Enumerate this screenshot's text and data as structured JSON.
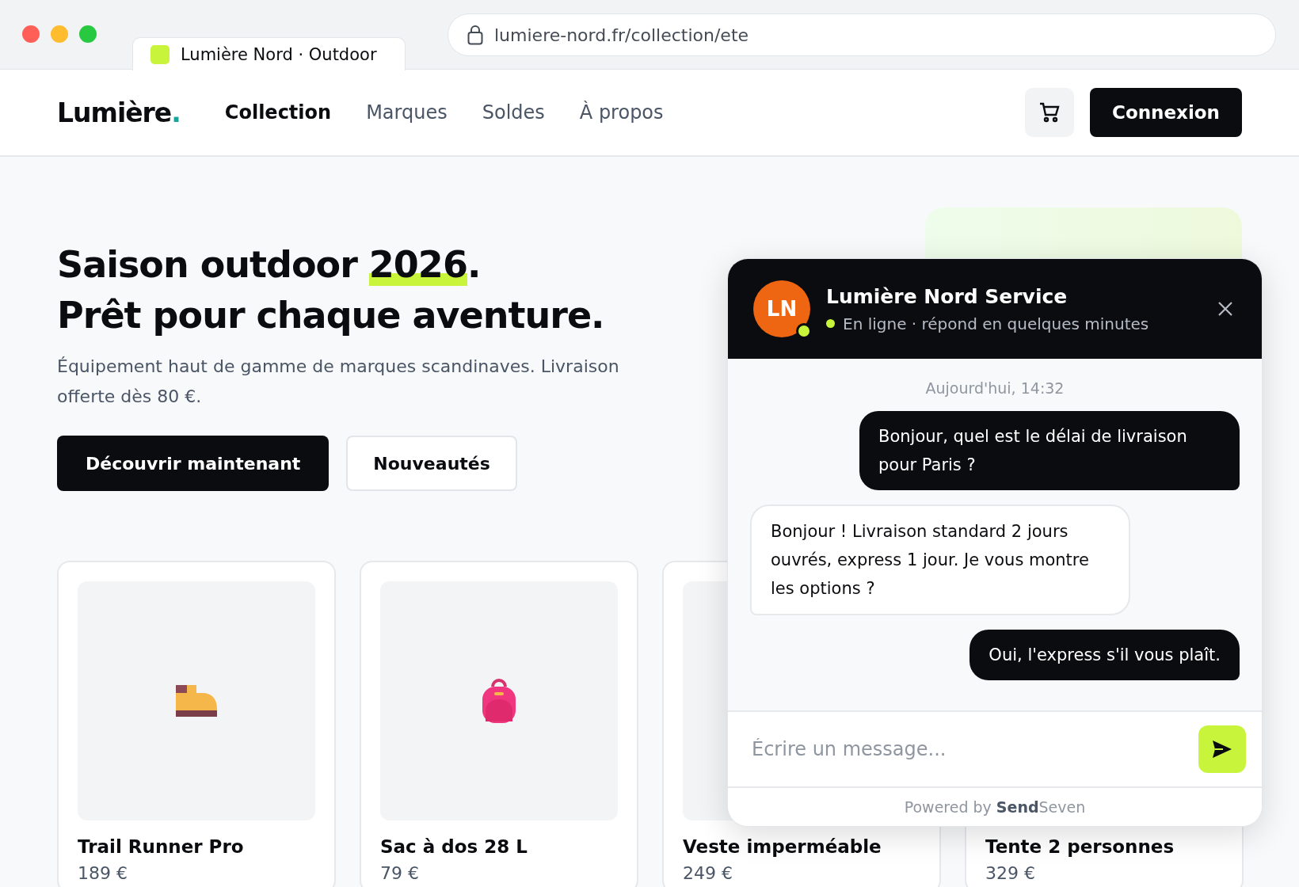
{
  "browser": {
    "tab_title": "Lumière Nord · Outdoor",
    "url": "lumiere-nord.fr/collection/ete"
  },
  "header": {
    "logo": "Lumière",
    "logo_dot": ".",
    "nav": [
      {
        "label": "Collection",
        "selected": true
      },
      {
        "label": "Marques",
        "selected": false
      },
      {
        "label": "Soldes",
        "selected": false
      },
      {
        "label": "À propos",
        "selected": false
      }
    ],
    "login": "Connexion"
  },
  "hero": {
    "title_before": "Saison outdoor ",
    "title_highlight": "2026",
    "title_after": ".",
    "title_line2": "Prêt pour chaque aventure.",
    "text": "Équipement haut de gamme de marques scandinaves. Livraison offerte dès 80 €.",
    "primary": "Découvrir maintenant",
    "secondary": "Nouveautés"
  },
  "products": [
    {
      "name": "Trail Runner Pro",
      "price": "189 €",
      "kind": "boot"
    },
    {
      "name": "Sac à dos 28 L",
      "price": "79 €",
      "kind": "backpack"
    },
    {
      "name": "Veste imperméable",
      "price": "249 €",
      "kind": "hidden"
    },
    {
      "name": "Tente 2 personnes",
      "price": "329 €",
      "kind": "covered"
    }
  ],
  "chat": {
    "initials": "LN",
    "name": "Lumière Nord Service",
    "online": true,
    "status": "En ligne · répond en quelques minutes",
    "date": "Aujourd'hui, 14:32",
    "messages": [
      {
        "kind": "outgoing",
        "text": "Bonjour, quel est le délai de livraison pour Paris ?"
      },
      {
        "kind": "incoming",
        "text": "Bonjour ! Livraison standard 2 jours ouvrés, express 1 jour. Je vous montre les options ?"
      },
      {
        "kind": "outgoing",
        "text": "Oui, l'express s'il vous plaît."
      }
    ],
    "placeholder": "Écrire un message...",
    "powered": "Powered by **Send**Seven"
  }
}
